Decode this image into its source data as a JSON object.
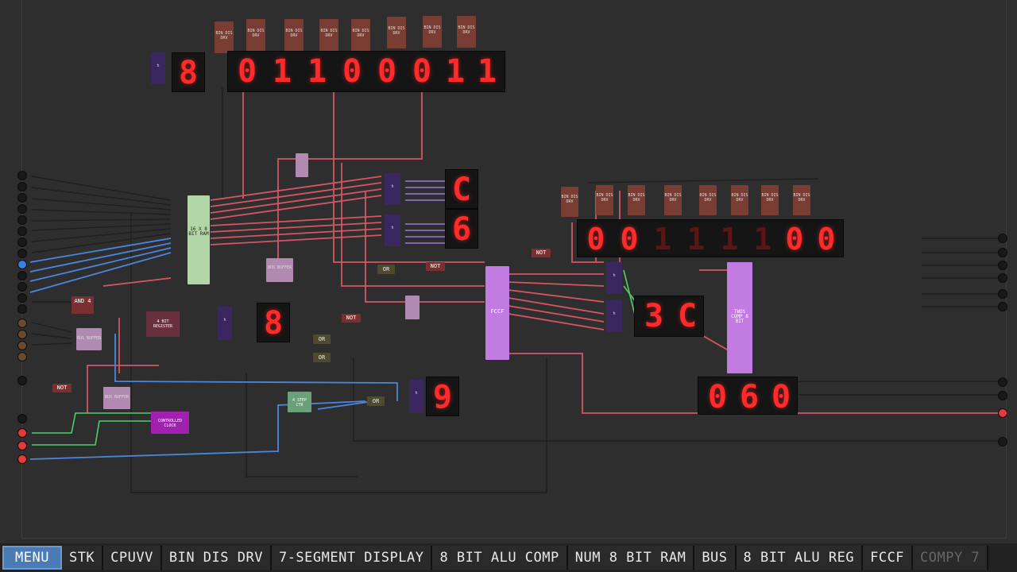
{
  "tabs": [
    {
      "label": "MENU",
      "active": true
    },
    {
      "label": "STK"
    },
    {
      "label": "CPUVV"
    },
    {
      "label": "BIN DIS DRV"
    },
    {
      "label": "7-SEGMENT DISPLAY"
    },
    {
      "label": "8 BIT ALU COMP"
    },
    {
      "label": "NUM 8 BIT RAM"
    },
    {
      "label": "BUS"
    },
    {
      "label": "8 BIT ALU REG"
    },
    {
      "label": "FCCF"
    },
    {
      "label": "COMPY 7",
      "faded": true
    }
  ],
  "displays": {
    "top_left_digit": "8",
    "top_binary": [
      "0",
      "1",
      "1",
      "0",
      "0",
      "0",
      "1",
      "1"
    ],
    "mid_digit_c": "C",
    "mid_digit_6": "6",
    "left_mid_digit": "8",
    "bottom_digit": "9",
    "right_binary": [
      "0",
      "0",
      "1",
      "1",
      "1",
      "1",
      "0",
      "0"
    ],
    "right_hex": [
      "3",
      "C"
    ],
    "right_decimal": [
      "0",
      "6",
      "0"
    ]
  },
  "chips": {
    "bin_dis_drv": "BIN DIS DRV",
    "fccf": "FCCF",
    "and4": "AND 4",
    "bit_register": "4 BIT REGISTER",
    "bus_buffer": "BUS BUFFER",
    "controlled_clock": "CONTROLLED CLOCK",
    "step_counter": "4 STEP CTR",
    "twos_comp": "TWOS COMP 8 BIT",
    "ram": "16 X 8 BIT RAM",
    "not": "NOT",
    "or": "OR",
    "h": "h"
  },
  "colors": {
    "accent_tab": "#4b7bb5",
    "wire_red": "#e85a6a",
    "wire_blue": "#4a86e0",
    "wire_green": "#4fcf6a",
    "seg_on": "#ff2a2a"
  }
}
